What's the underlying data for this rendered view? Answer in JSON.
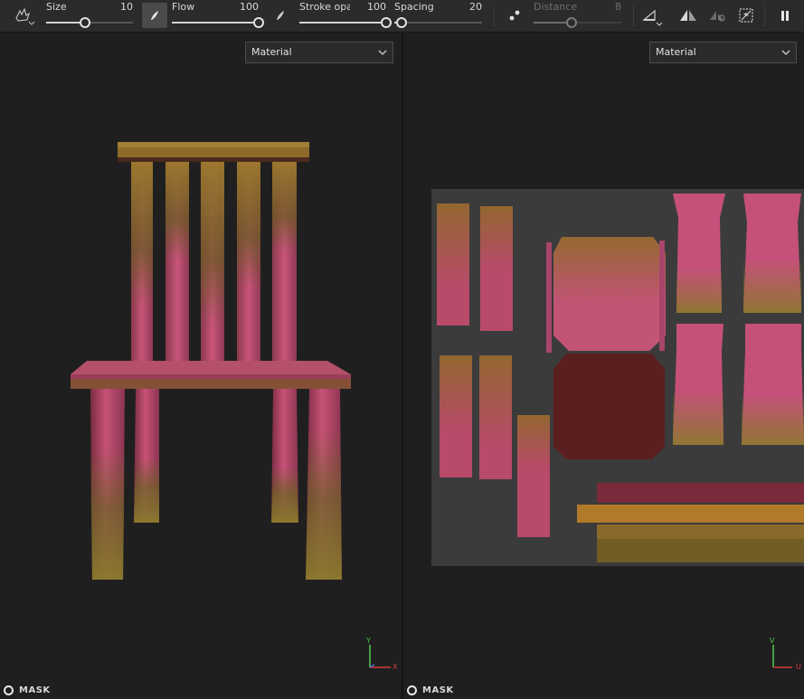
{
  "toolbar": {
    "sliders": [
      {
        "id": "size",
        "label": "Size",
        "value": "10",
        "fraction": 0.45,
        "enabled": true
      },
      {
        "id": "flow",
        "label": "Flow",
        "value": "100",
        "fraction": 1.0,
        "enabled": true
      },
      {
        "id": "stroke_opacity",
        "label": "Stroke opac",
        "value": "100",
        "fraction": 1.0,
        "enabled": true
      },
      {
        "id": "spacing",
        "label": "Spacing",
        "value": "20",
        "fraction": 0.08,
        "enabled": true
      },
      {
        "id": "distance",
        "label": "Distance",
        "value": "8",
        "fraction": 0.43,
        "enabled": false
      }
    ],
    "icons": {
      "brush_preset": "brush-preset-icon",
      "flow_pressure": "pen-pressure-icon",
      "stroke_pressure": "pen-pressure-icon",
      "spacing_mode": "dots-icon",
      "symmetry": "symmetry-icon",
      "mirror": "mirror-icon",
      "lazy_mouse": "lazy-mouse-icon",
      "wireframe": "wireframe-icon",
      "pause": "pause-icon"
    }
  },
  "viewport_3d": {
    "channel": "Material",
    "mask_label": "MASK",
    "axis_labels": {
      "vertical": "Y",
      "horizontal": "X"
    }
  },
  "viewport_2d": {
    "channel": "Material",
    "mask_label": "MASK",
    "axis_labels": {
      "vertical": "V",
      "horizontal": "U"
    }
  },
  "colors": {
    "toolbar_bg": "#2b2b2b",
    "viewport_bg": "#1f1f1f",
    "uv_bg": "#3b3b3b",
    "paint_pink": "#c95075",
    "rust_gold": "#a07a2a",
    "axis_green": "#4ec14e",
    "axis_red": "#d23c3c"
  }
}
